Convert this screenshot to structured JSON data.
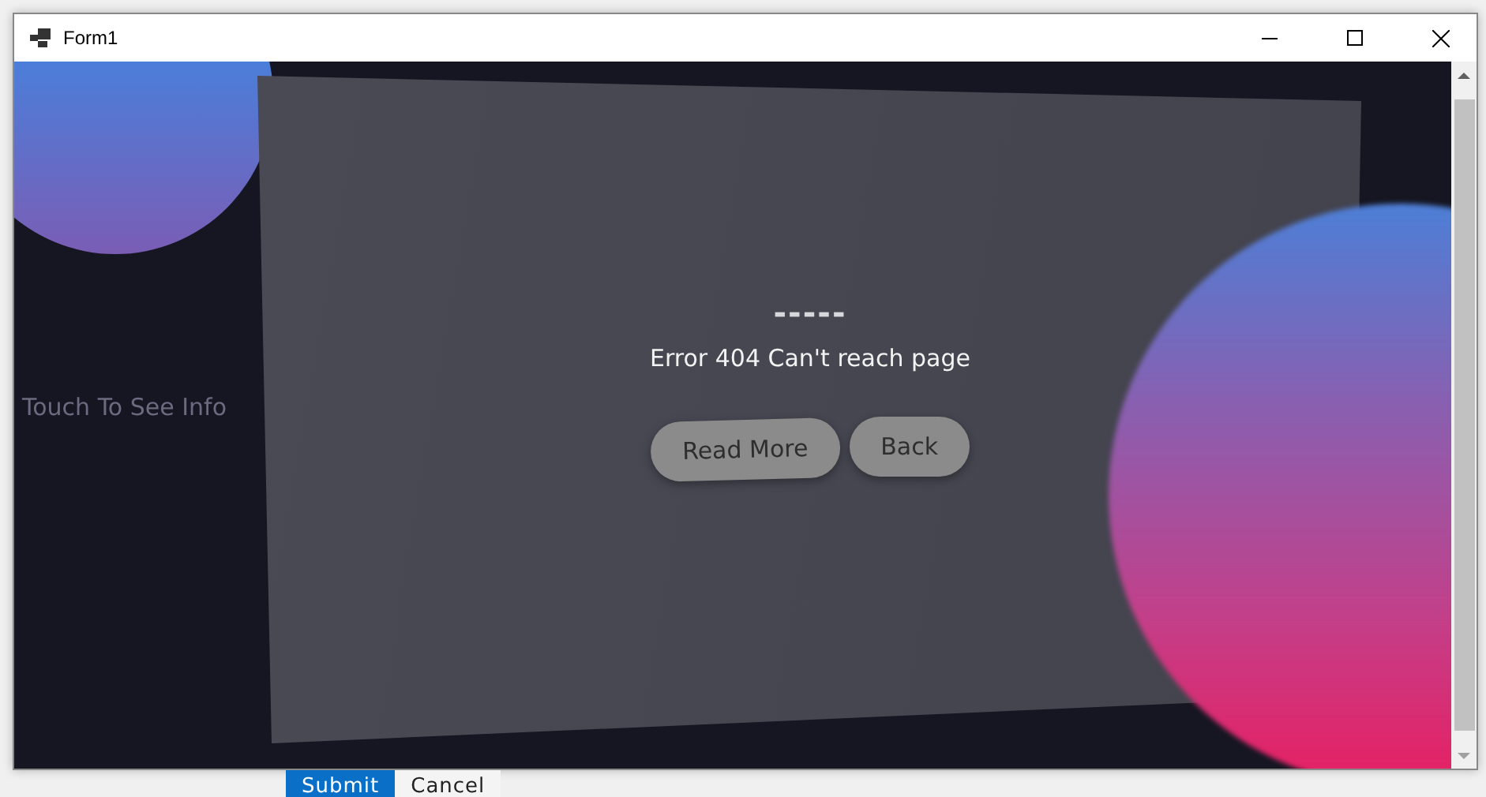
{
  "window": {
    "title": "Form1"
  },
  "side_label": "Touch To See Info",
  "card": {
    "dashes": "-----",
    "message": "Error 404 Can't reach page",
    "buttons": [
      "Read More",
      "Back"
    ]
  },
  "background_buttons": [
    {
      "label": "Submit",
      "primary": true
    },
    {
      "label": "Cancel",
      "primary": false
    }
  ]
}
